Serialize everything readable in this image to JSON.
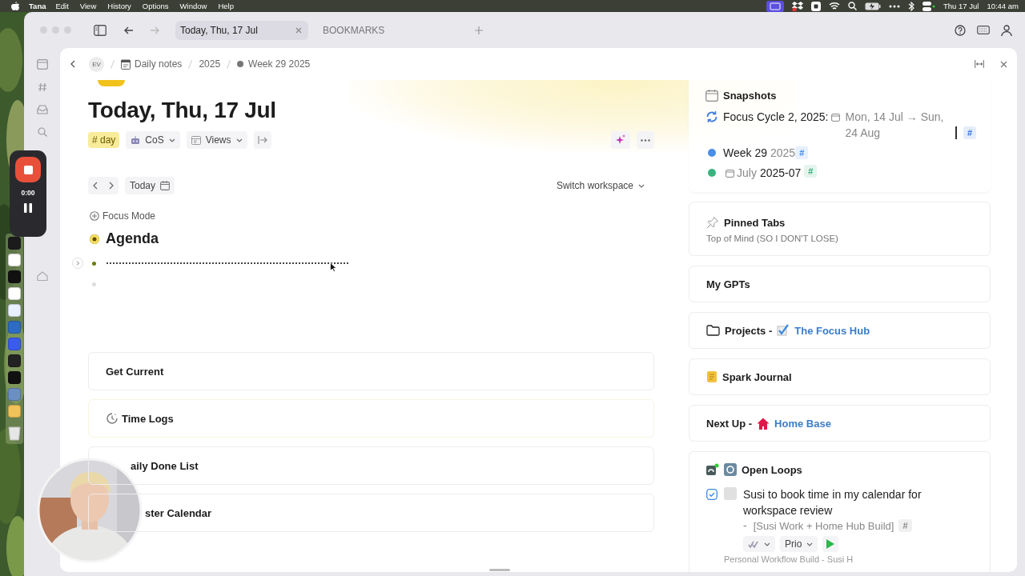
{
  "menu_bar": {
    "app": "Tana",
    "items": [
      "Edit",
      "View",
      "History",
      "Options",
      "Window",
      "Help"
    ],
    "date": "Thu 17 Jul",
    "time": "10:44 am"
  },
  "recorder": {
    "time": "0:00"
  },
  "toolbar": {
    "tabs": [
      {
        "label": "Today, Thu, 17 Jul",
        "selected": true
      },
      {
        "label": "BOOKMARKS",
        "selected": false
      }
    ]
  },
  "breadcrumb": {
    "avatar": "EV",
    "items": [
      "Daily notes",
      "2025",
      "Week 29 2025"
    ]
  },
  "page": {
    "title": "Today, Thu, 17 Jul",
    "tag": "# day",
    "chips": [
      {
        "label": "CoS",
        "kind": "robot"
      },
      {
        "label": "Views",
        "kind": "views"
      }
    ],
    "today": "Today",
    "workspace": "Switch workspace",
    "focus_mode": "Focus Mode",
    "agenda": "Agenda",
    "sections": [
      {
        "title": "Get Current",
        "kind": "plain"
      },
      {
        "title": "Time Logs",
        "kind": "clock"
      },
      {
        "title": "aily Done List",
        "kind": "plain"
      },
      {
        "title": "ster Calendar",
        "kind": "plain"
      }
    ]
  },
  "sidebar": {
    "snapshots": {
      "title": "Snapshots",
      "items": [
        {
          "kind": "cycle",
          "name": "Focus Cycle 2, 2025:",
          "detail": "Mon, 14 Jul → Sun, 24 Aug",
          "cursor": true,
          "tag": "#",
          "color": "#3d7be0"
        },
        {
          "kind": "dot",
          "name": "Week 29",
          "detail": "2025",
          "tag": "#",
          "color": "#4a8ee8"
        },
        {
          "kind": "dot",
          "prefix": "July",
          "name": "2025-07",
          "tag": "#",
          "color": "#3bb37f"
        }
      ]
    },
    "cards": [
      {
        "kind": "pinned",
        "title": "Pinned Tabs",
        "subtitle": "Top of Mind (SO I DON'T LOSE)"
      },
      {
        "kind": "plain",
        "title": "My GPTs"
      },
      {
        "kind": "folder",
        "title": "Projects -",
        "link": "The Focus Hub"
      },
      {
        "kind": "journal",
        "title": "Spark Journal"
      },
      {
        "kind": "home",
        "title": "Next Up -",
        "link": "Home Base"
      }
    ],
    "open_loops": {
      "title": "Open Loops",
      "task": {
        "text": "Susi to book time in my calendar for workspace review",
        "checked": false,
        "dash": "-",
        "ref": "[Susi Work + Home Hub Build]",
        "tag": "#",
        "prio": "Prio"
      },
      "footer": "Personal Workflow Build - Susi H"
    }
  }
}
